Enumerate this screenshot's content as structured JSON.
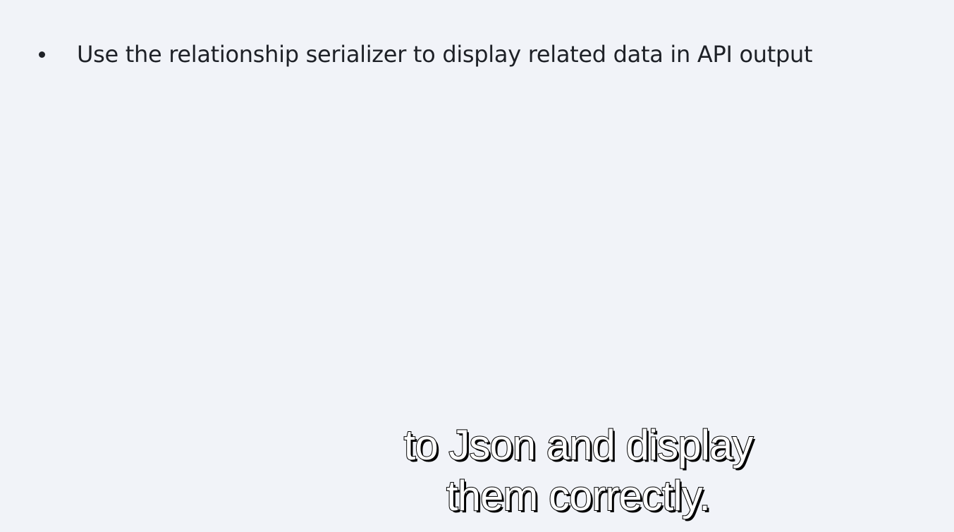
{
  "slide": {
    "bullets": [
      {
        "text": "Use the relationship serializer to display related data in API output"
      }
    ]
  },
  "caption": {
    "lines": [
      "to Json and display",
      "them correctly."
    ]
  }
}
